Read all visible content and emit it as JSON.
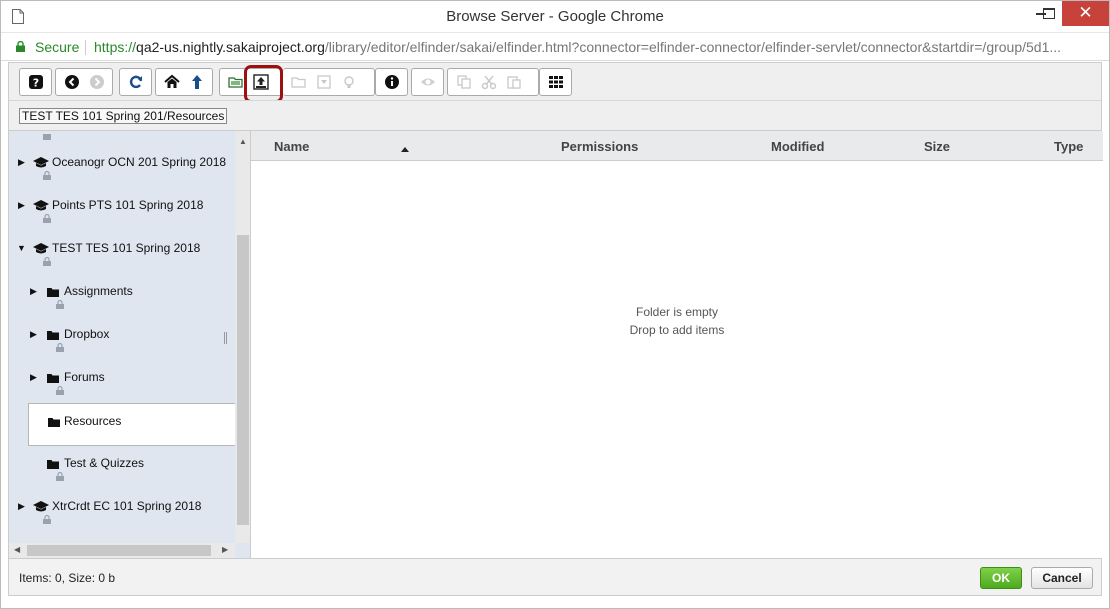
{
  "window": {
    "title": "Browse Server - Google Chrome",
    "close_glyph": "✕",
    "accent_close": "#c7423a"
  },
  "address": {
    "secure_label": "Secure",
    "url_scheme": "https://",
    "url_host": "qa2-us.nightly.sakaiproject.org",
    "url_path": "/library/editor/elfinder/sakai/elfinder.html?connector=elfinder-connector/elfinder-servlet/connector&startdir=/group/5d1..."
  },
  "toolbar": {
    "icons": [
      "help-icon",
      "back-icon",
      "forward-icon",
      "reload-icon",
      "home-icon",
      "up-icon",
      "open-folder-icon",
      "upload-icon",
      "open-icon",
      "download-icon",
      "getfile-icon",
      "info-icon",
      "preview-icon",
      "copy-icon",
      "cut-icon",
      "paste-icon",
      "view-icon"
    ],
    "highlighted": "upload-icon"
  },
  "path": {
    "crumb": "TEST TES 101 Spring 201/Resources"
  },
  "tree": {
    "items": [
      {
        "label": "Oceanogr OCN 201 Spring 2018",
        "type": "site",
        "expanded": false
      },
      {
        "label": "Points PTS 101 Spring 2018",
        "type": "site",
        "expanded": false
      },
      {
        "label": "TEST TES 101 Spring 2018",
        "type": "site",
        "expanded": true
      },
      {
        "label": "Assignments",
        "type": "folder",
        "expanded": false
      },
      {
        "label": "Dropbox",
        "type": "folder",
        "expanded": false
      },
      {
        "label": "Forums",
        "type": "folder",
        "expanded": false
      },
      {
        "label": "Resources",
        "type": "folder",
        "selected": true
      },
      {
        "label": "Test & Quizzes",
        "type": "folder"
      },
      {
        "label": "XtrCrdt EC 101 Spring 2018",
        "type": "site",
        "expanded": false
      }
    ]
  },
  "list": {
    "columns": [
      "Name",
      "Permissions",
      "Modified",
      "Size",
      "Type"
    ],
    "sort_column": "Name",
    "empty_line1": "Folder is empty",
    "empty_line2": "Drop to add items"
  },
  "status": {
    "text": "Items: 0, Size: 0 b"
  },
  "buttons": {
    "ok_label": "OK",
    "cancel_label": "Cancel",
    "ok_color": "#5cb82a"
  }
}
